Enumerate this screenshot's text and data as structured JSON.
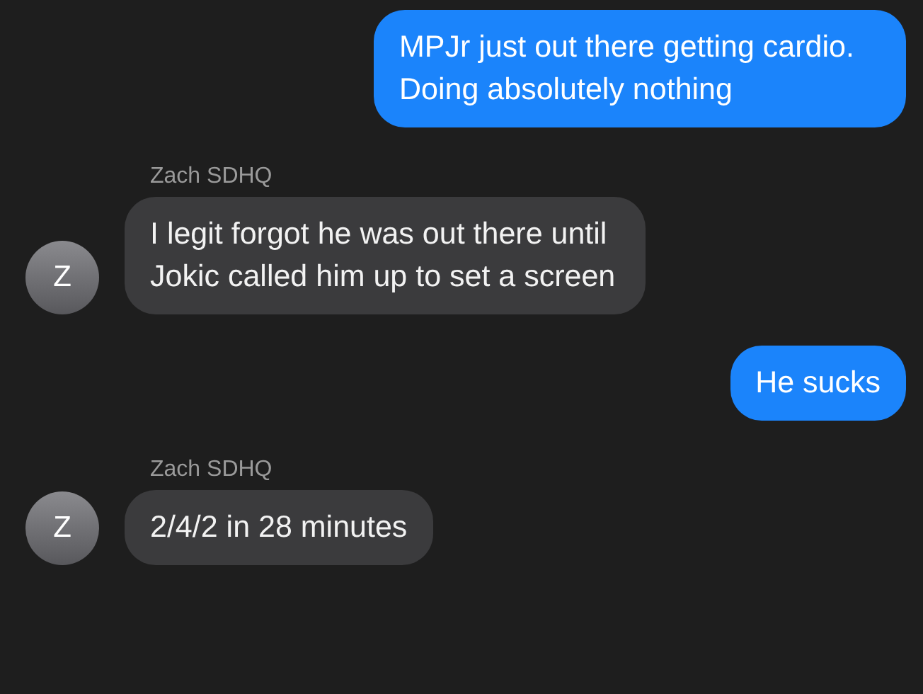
{
  "messages": [
    {
      "kind": "sent",
      "text": "MPJr just out there getting cardio. Doing absolutely nothing"
    },
    {
      "kind": "received",
      "sender": "Zach SDHQ",
      "avatar": "Z",
      "text": "I legit forgot he was out there until Jokic called him up to set a screen"
    },
    {
      "kind": "sent",
      "text": "He sucks"
    },
    {
      "kind": "received",
      "sender": "Zach SDHQ",
      "avatar": "Z",
      "text": "2/4/2 in 28 minutes"
    }
  ]
}
